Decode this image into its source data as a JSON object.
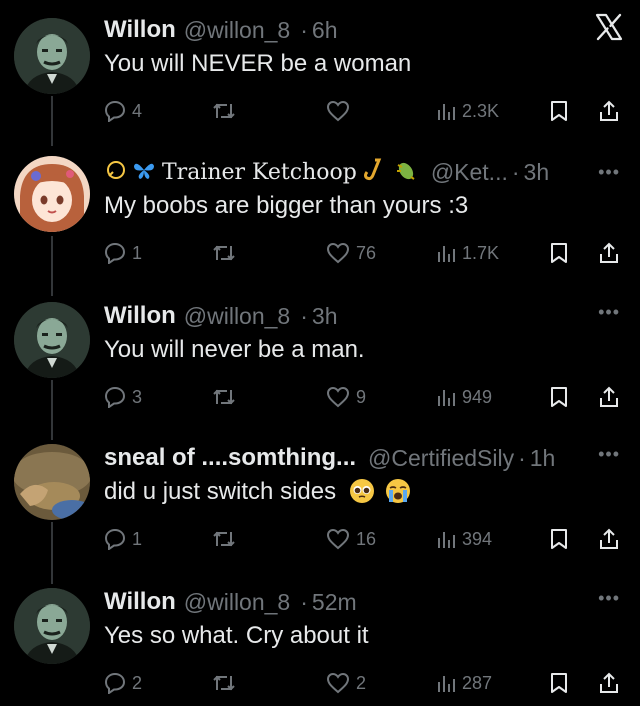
{
  "tweets": [
    {
      "name": "Willon",
      "handle": "@willon_8",
      "time": "6h",
      "text": "You will NEVER be a woman",
      "replies": "4",
      "likes": "",
      "views": "2.3K"
    },
    {
      "name": "Trainer Ketchoop",
      "handle": "@Ket...",
      "time": "3h",
      "text": "My boobs are bigger than yours :3",
      "replies": "1",
      "likes": "76",
      "views": "1.7K"
    },
    {
      "name": "Willon",
      "handle": "@willon_8",
      "time": "3h",
      "text": "You will never be a man.",
      "replies": "3",
      "likes": "9",
      "views": "949"
    },
    {
      "name": "sneal of ....somthing...",
      "handle": "@CertifiedSily",
      "time": "1h",
      "text": "did u just switch sides",
      "replies": "1",
      "likes": "16",
      "views": "394"
    },
    {
      "name": "Willon",
      "handle": "@willon_8",
      "time": "52m",
      "text": "Yes so what. Cry about it",
      "replies": "2",
      "likes": "2",
      "views": "287"
    }
  ],
  "icons": {
    "close": "x-logo-icon",
    "reply": "reply-icon",
    "retweet": "retweet-icon",
    "like": "heart-icon",
    "views": "views-icon",
    "bookmark": "bookmark-icon",
    "share": "share-icon",
    "more": "more-icon"
  },
  "colors": {
    "background": "#000000",
    "text": "#e7e9ea",
    "muted": "#71767b",
    "thread_line": "#333639"
  }
}
